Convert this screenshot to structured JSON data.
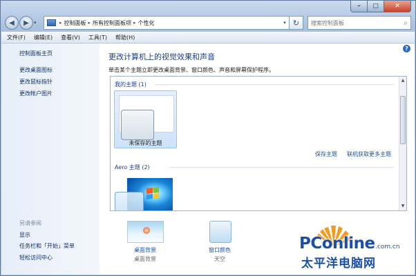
{
  "window": {
    "caption": {
      "minimize": "–",
      "maximize": "□",
      "close": "✕"
    },
    "nav": {
      "back": "◀",
      "forward": "▶",
      "history": "▾"
    },
    "breadcrumb": [
      "控制面板",
      "所有控制面板项",
      "个性化"
    ],
    "refresh": "↻",
    "search": {
      "placeholder": "搜索控制面板"
    }
  },
  "menubar": [
    "文件(F)",
    "编辑(E)",
    "查看(V)",
    "工具(T)",
    "帮助(H)"
  ],
  "sidebar": {
    "home": "控制面板主页",
    "links": [
      "更改桌面图标",
      "更改鼠标指针",
      "更改帐户图片"
    ],
    "see_also_heading": "另请参阅",
    "see_also": [
      "显示",
      "任务栏和「开始」菜单",
      "轻松访问中心"
    ]
  },
  "main": {
    "help": "?",
    "heading": "更改计算机上的视觉效果和声音",
    "subtitle": "单击某个主题立即更改桌面背景、窗口颜色、声音和屏幕保护程序。",
    "my_themes": {
      "title": "我的主题 (1)",
      "theme_name": "未保存的主题",
      "save_link": "保存主题",
      "online_link": "联机获取更多主题"
    },
    "aero_themes": {
      "title": "Aero 主题 (2)"
    }
  },
  "bottom": {
    "desktop_background": {
      "label": "桌面背景",
      "value": "桌面背景"
    },
    "window_color": {
      "label": "窗口颜色",
      "value": "天空"
    }
  },
  "watermark": {
    "brand": "PConline",
    "domain": ".com.cn",
    "cn": "太平洋电脑网"
  },
  "colors": {
    "accent": "#1e3c8c",
    "link": "#1b51a3",
    "watermark_blue": "#1b4fa8",
    "watermark_orange": "#f39a1f"
  }
}
